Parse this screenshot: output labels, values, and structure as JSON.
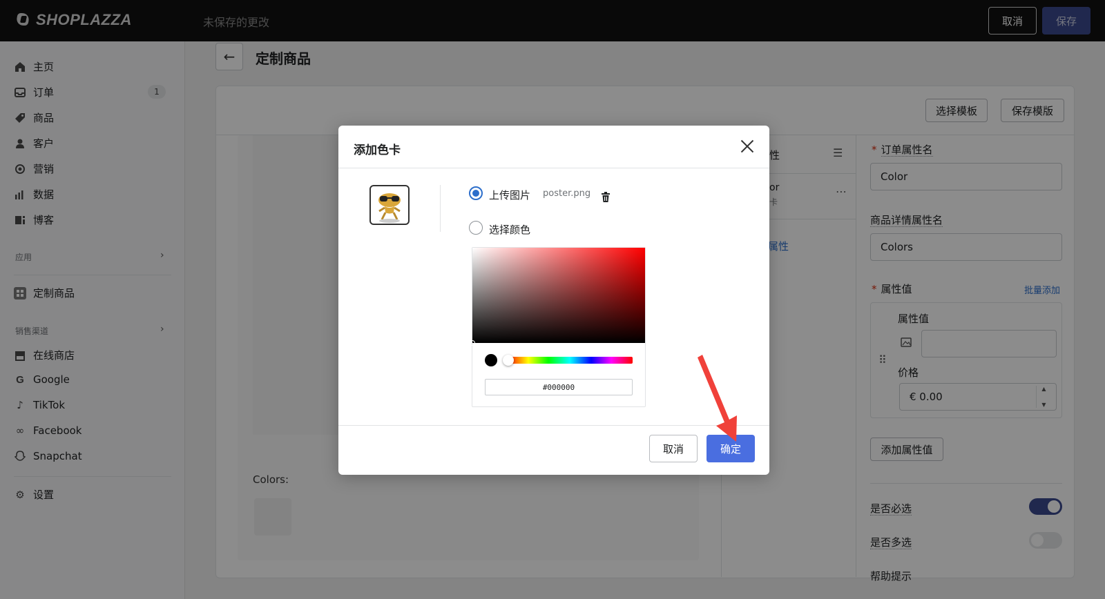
{
  "topbar": {
    "logo_text": "SHOPLAZZA",
    "unsaved": "未保存的更改",
    "cancel_label": "取消",
    "save_label": "保存"
  },
  "sidebar": {
    "items": [
      {
        "label": "主页",
        "icon": "home-icon"
      },
      {
        "label": "订单",
        "icon": "inbox-icon",
        "badge": "1"
      },
      {
        "label": "商品",
        "icon": "tag-icon"
      },
      {
        "label": "客户",
        "icon": "person-icon"
      },
      {
        "label": "营销",
        "icon": "target-icon"
      },
      {
        "label": "数据",
        "icon": "bar-chart-icon"
      },
      {
        "label": "博客",
        "icon": "blog-icon"
      }
    ],
    "apps_section": "应用",
    "app_item": "定制商品",
    "channels_section": "销售渠道",
    "channels": [
      {
        "label": "在线商店",
        "icon": "store-icon"
      },
      {
        "label": "Google",
        "icon": "google-icon"
      },
      {
        "label": "TikTok",
        "icon": "tiktok-icon"
      },
      {
        "label": "Facebook",
        "icon": "meta-icon"
      },
      {
        "label": "Snapchat",
        "icon": "snapchat-icon"
      }
    ],
    "settings": "设置"
  },
  "page": {
    "title": "定制商品",
    "select_template": "选择模板",
    "save_template": "保存模版",
    "colors_label": "Colors:",
    "mid_header_partial": "性",
    "mid_row_partial": "or",
    "mid_row_sub_partial": "卡",
    "mid_link_partial": "属性"
  },
  "right_panel": {
    "order_attr_label": "订单属性名",
    "order_attr_value": "Color",
    "detail_attr_label": "商品详情属性名",
    "detail_attr_value": "Colors",
    "attr_values_label": "属性值",
    "bulk_add": "批量添加",
    "value_label": "属性值",
    "value_input": "",
    "price_label": "价格",
    "price_value": "€ 0.00",
    "add_value_button": "添加属性值",
    "required_label": "是否必选",
    "required_on": true,
    "multi_label": "是否多选",
    "multi_on": false,
    "help_label": "帮助提示"
  },
  "modal": {
    "title": "添加色卡",
    "upload_label": "上传图片",
    "file_name": "poster.png",
    "choose_color_label": "选择颜色",
    "hex_value": "#000000",
    "cancel_label": "取消",
    "ok_label": "确定",
    "selected_option": "upload"
  },
  "colors": {
    "accent": "#4a6ee0",
    "toggle_on": "#3b4a8e",
    "annotation_arrow": "#f0413a"
  }
}
